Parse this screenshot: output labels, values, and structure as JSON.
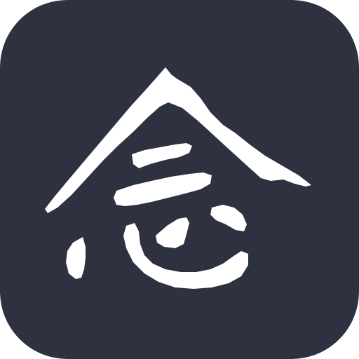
{
  "app_icon": {
    "glyph": "念",
    "background_color": "#2d3140",
    "glyph_color": "#ffffff"
  }
}
